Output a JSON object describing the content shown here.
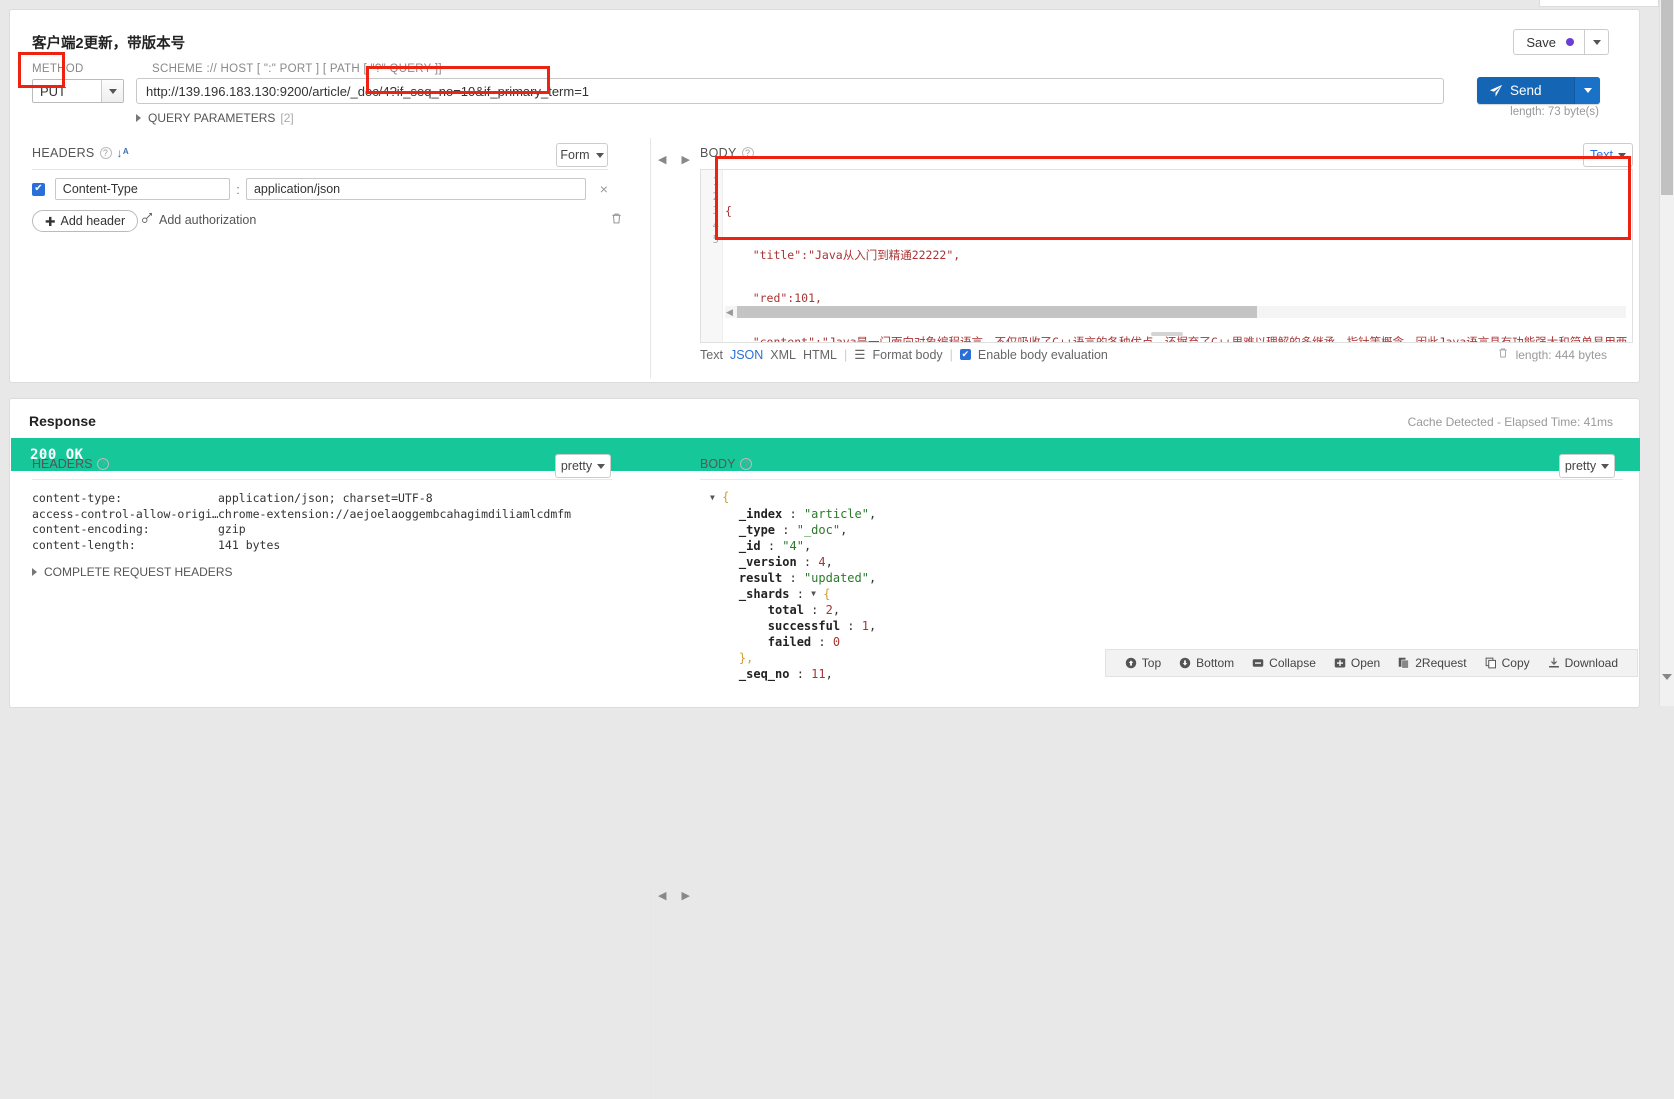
{
  "request": {
    "title": "客户端2更新，带版本号",
    "save_label": "Save",
    "method_label": "METHOD",
    "method_value": "PUT",
    "scheme_label": "SCHEME :// HOST [ \":\" PORT ] [ PATH [ \"?\" QUERY ]]",
    "url_value": "http://139.196.183.130:9200/article/_doc/4?if_seq_no=10&if_primary_term=1",
    "send_label": "Send",
    "length_label": "length: 73 byte(s)",
    "query_parameters_label": "QUERY PARAMETERS",
    "query_parameters_count": "[2]",
    "headers": {
      "title": "HEADERS",
      "mode_label": "Form",
      "rows": [
        {
          "enabled": true,
          "key": "Content-Type",
          "value": "application/json"
        }
      ],
      "add_header_label": "Add header",
      "add_authorization_label": "Add authorization"
    },
    "body": {
      "title": "BODY",
      "format_label": "Text",
      "line_numbers": [
        "1",
        "2",
        "3",
        "4",
        "5"
      ],
      "lines": [
        "{",
        "    \"title\":\"Java从入门到精通22222\",",
        "    \"red\":101,",
        "    \"content\":\"Java是一门面向对象编程语言，不仅吸收了C++语言的各种优点，还摒弃了C++里难以理解的多继承、指针等概念，因此Java语言具有功能强大和简单易用两",
        "}"
      ],
      "footer": {
        "text_label": "Text",
        "json_label": "JSON",
        "xml_label": "XML",
        "html_label": "HTML",
        "format_body_label": "Format body",
        "enable_body_evaluation_label": "Enable body evaluation",
        "length_label": "length: 444 bytes"
      }
    }
  },
  "response": {
    "title": "Response",
    "cache_info": "Cache Detected - Elapsed Time: 41ms",
    "status_text": "200 OK",
    "status_color": "#16c79a",
    "headers": {
      "title": "HEADERS",
      "view_label": "pretty",
      "rows": [
        {
          "key": "content-type:",
          "value": "application/json; charset=UTF-8"
        },
        {
          "key": "access-control-allow-origi…",
          "value": "chrome-extension://aejoelaoggembcahagimdiliamlcdmfm"
        },
        {
          "key": "content-encoding:",
          "value": "gzip"
        },
        {
          "key": "content-length:",
          "value": "141 bytes"
        }
      ],
      "complete_request_headers_label": "COMPLETE REQUEST HEADERS"
    },
    "body": {
      "title": "BODY",
      "view_label": "pretty",
      "lines": [
        {
          "indent": 0,
          "toggle": true,
          "text": "{",
          "kind": "brace"
        },
        {
          "indent": 1,
          "toggle": false,
          "key": "_index",
          "value": "\"article\"",
          "kind": "string",
          "comma": true
        },
        {
          "indent": 1,
          "toggle": false,
          "key": "_type",
          "value": "\"_doc\"",
          "kind": "string",
          "comma": true
        },
        {
          "indent": 1,
          "toggle": false,
          "key": "_id",
          "value": "\"4\"",
          "kind": "string",
          "comma": true
        },
        {
          "indent": 1,
          "toggle": false,
          "key": "_version",
          "value": "4",
          "kind": "number",
          "comma": true
        },
        {
          "indent": 1,
          "toggle": false,
          "key": "result",
          "value": "\"updated\"",
          "kind": "string",
          "comma": true
        },
        {
          "indent": 1,
          "toggle": true,
          "key": "_shards",
          "value": "{",
          "kind": "brace",
          "comma": false
        },
        {
          "indent": 2,
          "toggle": false,
          "key": "total",
          "value": "2",
          "kind": "number",
          "comma": true
        },
        {
          "indent": 2,
          "toggle": false,
          "key": "successful",
          "value": "1",
          "kind": "number",
          "comma": true
        },
        {
          "indent": 2,
          "toggle": false,
          "key": "failed",
          "value": "0",
          "kind": "number",
          "comma": false
        },
        {
          "indent": 1,
          "toggle": false,
          "text": "},",
          "kind": "brace"
        },
        {
          "indent": 1,
          "toggle": false,
          "key": "_seq_no",
          "value": "11",
          "kind": "number",
          "comma": true
        }
      ]
    },
    "toolbar": [
      {
        "name": "top",
        "label": "Top"
      },
      {
        "name": "bottom",
        "label": "Bottom"
      },
      {
        "name": "collapse",
        "label": "Collapse"
      },
      {
        "name": "open",
        "label": "Open"
      },
      {
        "name": "request",
        "label": "2Request"
      },
      {
        "name": "copy",
        "label": "Copy"
      },
      {
        "name": "download",
        "label": "Download"
      }
    ]
  }
}
